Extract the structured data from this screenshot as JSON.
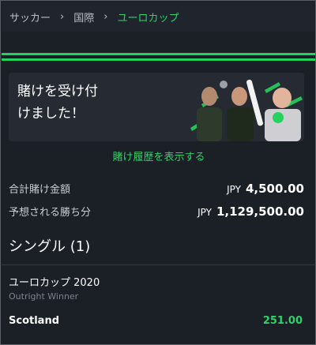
{
  "breadcrumb": {
    "items": [
      "サッカー",
      "国際",
      "ユーロカップ"
    ],
    "separator": "›"
  },
  "banner": {
    "line1": "賭けを受け付",
    "line2": "けました！"
  },
  "history_link": "賭け履歴を表示する",
  "summary": {
    "total_stake": {
      "label": "合計賭け金額",
      "currency": "JPY",
      "value": "4,500.00"
    },
    "potential_win": {
      "label": "予想される勝ち分",
      "currency": "JPY",
      "value": "1,129,500.00"
    }
  },
  "section": {
    "title": "シングル (1)"
  },
  "bet": {
    "event": "ユーロカップ 2020",
    "market": "Outright Winner",
    "selection": "Scotland",
    "odds": "251.00"
  },
  "colors": {
    "accent": "#2fd36a",
    "background": "#1b1f26",
    "breadcrumb_bg": "#20252d",
    "banner_bg": "#262b33"
  },
  "icons": [
    "chevron-right-icon"
  ]
}
